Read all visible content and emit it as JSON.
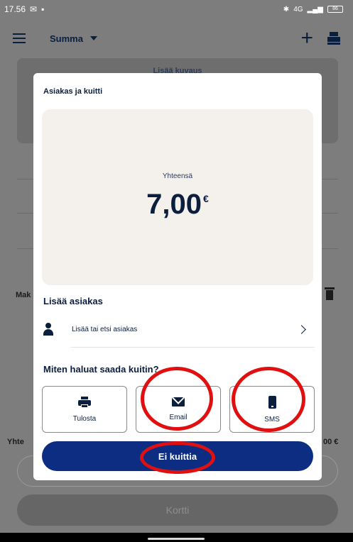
{
  "status_bar": {
    "time": "17.56",
    "network": "4G",
    "battery": "86"
  },
  "app_bar": {
    "title": "Summa",
    "icons": [
      "menu-icon",
      "chevron-down-icon",
      "plus-icon",
      "cash-register-icon"
    ]
  },
  "background": {
    "description_label": "Lisää kuvaus",
    "payment_label": "Mak",
    "total_label": "Yhte",
    "total_value": "00 €",
    "card_button": "Kortti"
  },
  "modal": {
    "title": "Asiakas ja kuitti",
    "total_label": "Yhteensä",
    "total_amount": "7,00",
    "currency": "€",
    "add_customer_title": "Lisää asiakas",
    "add_customer_label": "Lisää tai etsi asiakas",
    "receipt_question": "Miten haluat saada kuitin?",
    "options": [
      {
        "label": "Tulosta",
        "icon": "printer-icon"
      },
      {
        "label": "Email",
        "icon": "mail-icon"
      },
      {
        "label": "SMS",
        "icon": "phone-icon"
      }
    ],
    "no_receipt_button": "Ei kuittia"
  },
  "colors": {
    "primary": "#0c2d82",
    "dark_text": "#0b1e3d",
    "annotation": "#e11010",
    "card_bg": "#f4f1ec",
    "overlay": "#7d7d7d"
  }
}
